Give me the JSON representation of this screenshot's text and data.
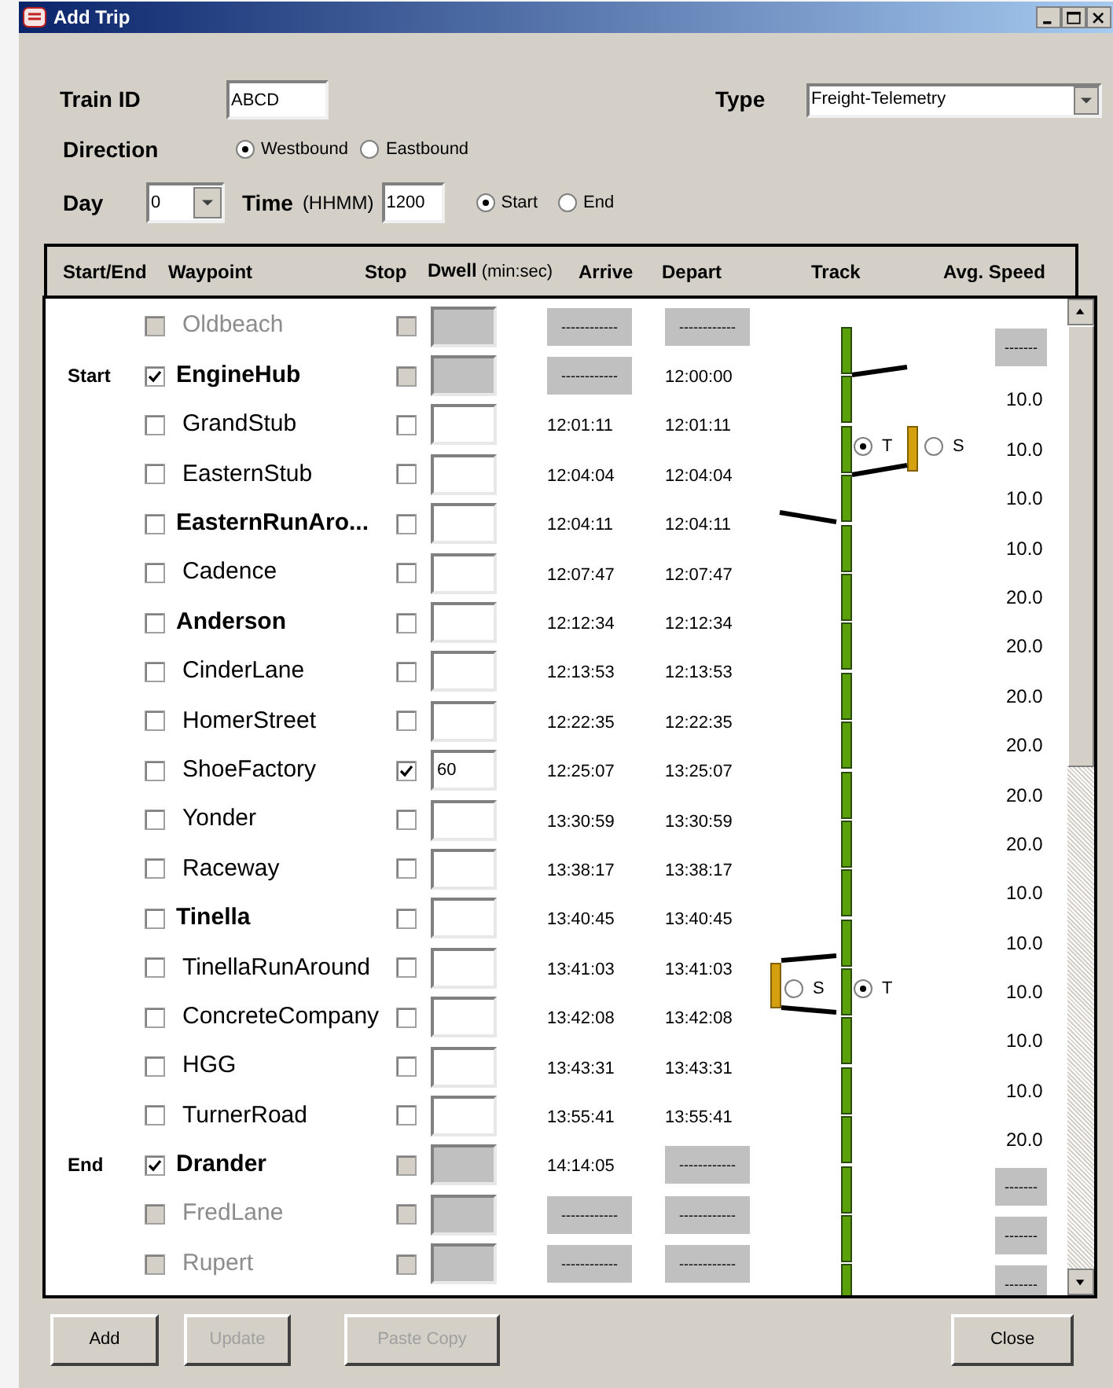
{
  "window": {
    "title": "Add Trip"
  },
  "form": {
    "train_id_label": "Train ID",
    "train_id": "ABCD",
    "type_label": "Type",
    "type": "Freight-Telemetry",
    "direction_label": "Direction",
    "directions": [
      {
        "label": "Westbound",
        "selected": true
      },
      {
        "label": "Eastbound",
        "selected": false
      }
    ],
    "day_label": "Day",
    "day": "0",
    "time_label": "Time",
    "time_hint": "(HHMM)",
    "time": "1200",
    "time_modes": [
      {
        "label": "Start",
        "selected": true
      },
      {
        "label": "End",
        "selected": false
      }
    ]
  },
  "table": {
    "columns": [
      "Start/End",
      "Waypoint",
      "Stop",
      "Dwell",
      "(min:sec)",
      "Arrive",
      "Depart",
      "Track",
      "Avg. Speed"
    ],
    "rows": [
      {
        "name": "Oldbeach",
        "checked": false,
        "enabled": false,
        "bold": false,
        "stop": {
          "checked": false,
          "enabled": false
        },
        "arrive": {
          "text": "------------",
          "disabled": true
        },
        "depart": {
          "text": "------------",
          "disabled": true
        },
        "speed": {
          "text": "-------",
          "disabled": true
        }
      },
      {
        "start_end": "Start",
        "name": "EngineHub",
        "checked": true,
        "enabled": true,
        "bold": true,
        "stop": {
          "checked": false,
          "enabled": false
        },
        "arrive": {
          "text": "------------",
          "disabled": true
        },
        "depart": {
          "text": "12:00:00",
          "disabled": false
        },
        "speed": {
          "text": "10.0",
          "disabled": false
        },
        "branch": {
          "kind": "right"
        }
      },
      {
        "name": "GrandStub",
        "checked": false,
        "enabled": true,
        "bold": false,
        "stop": {
          "checked": false,
          "enabled": true
        },
        "arrive": {
          "text": "12:01:11",
          "disabled": false
        },
        "depart": {
          "text": "12:01:11",
          "disabled": false
        },
        "speed": {
          "text": "10.0",
          "disabled": false
        },
        "switch": {
          "kind": "right",
          "options": [
            {
              "label": "T",
              "selected": true
            },
            {
              "label": "S",
              "selected": false
            }
          ]
        }
      },
      {
        "name": "EasternStub",
        "checked": false,
        "enabled": true,
        "bold": false,
        "stop": {
          "checked": false,
          "enabled": true
        },
        "arrive": {
          "text": "12:04:04",
          "disabled": false
        },
        "depart": {
          "text": "12:04:04",
          "disabled": false
        },
        "speed": {
          "text": "10.0",
          "disabled": false
        }
      },
      {
        "name": "EasternRunAro...",
        "checked": false,
        "enabled": true,
        "bold": true,
        "stop": {
          "checked": false,
          "enabled": true
        },
        "arrive": {
          "text": "12:04:11",
          "disabled": false
        },
        "depart": {
          "text": "12:04:11",
          "disabled": false
        },
        "speed": {
          "text": "10.0",
          "disabled": false
        },
        "branch": {
          "kind": "left"
        }
      },
      {
        "name": "Cadence",
        "checked": false,
        "enabled": true,
        "bold": false,
        "stop": {
          "checked": false,
          "enabled": true
        },
        "arrive": {
          "text": "12:07:47",
          "disabled": false
        },
        "depart": {
          "text": "12:07:47",
          "disabled": false
        },
        "speed": {
          "text": "20.0",
          "disabled": false
        }
      },
      {
        "name": "Anderson",
        "checked": false,
        "enabled": true,
        "bold": true,
        "stop": {
          "checked": false,
          "enabled": true
        },
        "arrive": {
          "text": "12:12:34",
          "disabled": false
        },
        "depart": {
          "text": "12:12:34",
          "disabled": false
        },
        "speed": {
          "text": "20.0",
          "disabled": false
        }
      },
      {
        "name": "CinderLane",
        "checked": false,
        "enabled": true,
        "bold": false,
        "stop": {
          "checked": false,
          "enabled": true
        },
        "arrive": {
          "text": "12:13:53",
          "disabled": false
        },
        "depart": {
          "text": "12:13:53",
          "disabled": false
        },
        "speed": {
          "text": "20.0",
          "disabled": false
        }
      },
      {
        "name": "HomerStreet",
        "checked": false,
        "enabled": true,
        "bold": false,
        "stop": {
          "checked": false,
          "enabled": true
        },
        "arrive": {
          "text": "12:22:35",
          "disabled": false
        },
        "depart": {
          "text": "12:22:35",
          "disabled": false
        },
        "speed": {
          "text": "20.0",
          "disabled": false
        }
      },
      {
        "name": "ShoeFactory",
        "checked": false,
        "enabled": true,
        "bold": false,
        "stop": {
          "checked": true,
          "enabled": true
        },
        "dwell": "60",
        "arrive": {
          "text": "12:25:07",
          "disabled": false
        },
        "depart": {
          "text": "13:25:07",
          "disabled": false
        },
        "speed": {
          "text": "20.0",
          "disabled": false
        }
      },
      {
        "name": "Yonder",
        "checked": false,
        "enabled": true,
        "bold": false,
        "stop": {
          "checked": false,
          "enabled": true
        },
        "arrive": {
          "text": "13:30:59",
          "disabled": false
        },
        "depart": {
          "text": "13:30:59",
          "disabled": false
        },
        "speed": {
          "text": "20.0",
          "disabled": false
        }
      },
      {
        "name": "Raceway",
        "checked": false,
        "enabled": true,
        "bold": false,
        "stop": {
          "checked": false,
          "enabled": true
        },
        "arrive": {
          "text": "13:38:17",
          "disabled": false
        },
        "depart": {
          "text": "13:38:17",
          "disabled": false
        },
        "speed": {
          "text": "10.0",
          "disabled": false
        }
      },
      {
        "name": "Tinella",
        "checked": false,
        "enabled": true,
        "bold": true,
        "stop": {
          "checked": false,
          "enabled": true
        },
        "arrive": {
          "text": "13:40:45",
          "disabled": false
        },
        "depart": {
          "text": "13:40:45",
          "disabled": false
        },
        "speed": {
          "text": "10.0",
          "disabled": false
        }
      },
      {
        "name": "TinellaRunAround",
        "checked": false,
        "enabled": true,
        "bold": false,
        "stop": {
          "checked": false,
          "enabled": true
        },
        "arrive": {
          "text": "13:41:03",
          "disabled": false
        },
        "depart": {
          "text": "13:41:03",
          "disabled": false
        },
        "speed": {
          "text": "10.0",
          "disabled": false
        },
        "switch": {
          "kind": "left",
          "options": [
            {
              "label": "S",
              "selected": false
            },
            {
              "label": "T",
              "selected": true
            }
          ]
        }
      },
      {
        "name": "ConcreteCompany",
        "checked": false,
        "enabled": true,
        "bold": false,
        "stop": {
          "checked": false,
          "enabled": true
        },
        "arrive": {
          "text": "13:42:08",
          "disabled": false
        },
        "depart": {
          "text": "13:42:08",
          "disabled": false
        },
        "speed": {
          "text": "10.0",
          "disabled": false
        }
      },
      {
        "name": "HGG",
        "checked": false,
        "enabled": true,
        "bold": false,
        "stop": {
          "checked": false,
          "enabled": true
        },
        "arrive": {
          "text": "13:43:31",
          "disabled": false
        },
        "depart": {
          "text": "13:43:31",
          "disabled": false
        },
        "speed": {
          "text": "10.0",
          "disabled": false
        }
      },
      {
        "name": "TurnerRoad",
        "checked": false,
        "enabled": true,
        "bold": false,
        "stop": {
          "checked": false,
          "enabled": true
        },
        "arrive": {
          "text": "13:55:41",
          "disabled": false
        },
        "depart": {
          "text": "13:55:41",
          "disabled": false
        },
        "speed": {
          "text": "20.0",
          "disabled": false
        }
      },
      {
        "start_end": "End",
        "name": "Drander",
        "checked": true,
        "enabled": true,
        "bold": true,
        "stop": {
          "checked": false,
          "enabled": false
        },
        "arrive": {
          "text": "14:14:05",
          "disabled": false
        },
        "depart": {
          "text": "------------",
          "disabled": true
        },
        "speed": {
          "text": "-------",
          "disabled": true
        }
      },
      {
        "name": "FredLane",
        "checked": false,
        "enabled": false,
        "bold": false,
        "stop": {
          "checked": false,
          "enabled": false
        },
        "arrive": {
          "text": "------------",
          "disabled": true
        },
        "depart": {
          "text": "------------",
          "disabled": true
        },
        "speed": {
          "text": "-------",
          "disabled": true
        }
      },
      {
        "name": "Rupert",
        "checked": false,
        "enabled": false,
        "bold": false,
        "stop": {
          "checked": false,
          "enabled": false
        },
        "arrive": {
          "text": "------------",
          "disabled": true
        },
        "depart": {
          "text": "------------",
          "disabled": true
        },
        "speed": {
          "text": "-------",
          "disabled": true
        }
      }
    ]
  },
  "buttons": [
    {
      "label": "Add",
      "enabled": true
    },
    {
      "label": "Update",
      "enabled": false
    },
    {
      "label": "Paste Copy",
      "enabled": false
    },
    {
      "label": "Close",
      "enabled": true
    }
  ]
}
